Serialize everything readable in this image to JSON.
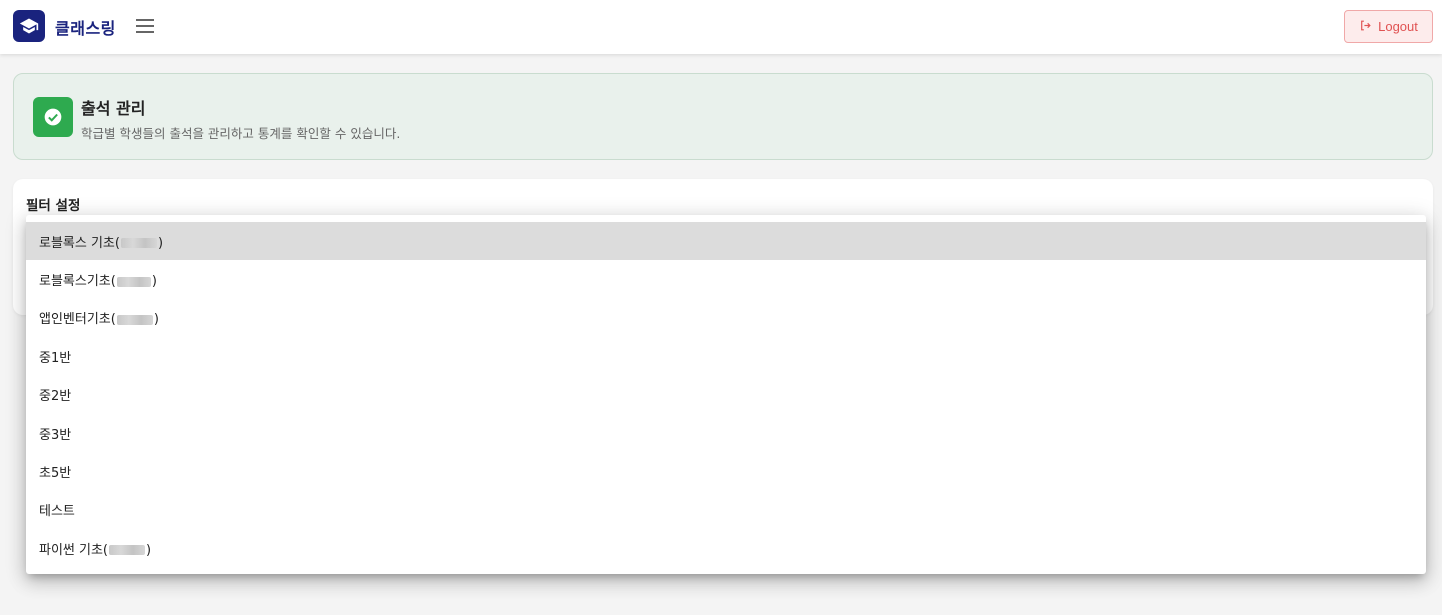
{
  "app": {
    "brand": "클래스링",
    "logout_label": "Logout"
  },
  "header": {
    "title": "출석 관리",
    "subtitle": "학급별 학생들의 출석을 관리하고 통계를 확인할 수 있습니다."
  },
  "filter": {
    "title": "필터 설정"
  },
  "dropdown": {
    "options": [
      {
        "prefix": "로블록스 기초(",
        "suffix": ")",
        "selected": true
      },
      {
        "prefix": "로블록스기초(",
        "suffix": ")",
        "selected": false
      },
      {
        "prefix": "앱인벤터기초(",
        "suffix": ")",
        "selected": false
      },
      {
        "prefix": "중1반",
        "suffix": "",
        "selected": false
      },
      {
        "prefix": "중2반",
        "suffix": "",
        "selected": false
      },
      {
        "prefix": "중3반",
        "suffix": "",
        "selected": false
      },
      {
        "prefix": "초5반",
        "suffix": "",
        "selected": false
      },
      {
        "prefix": "테스트",
        "suffix": "",
        "selected": false
      },
      {
        "prefix": "파이썬 기초(",
        "suffix": ")",
        "selected": false
      }
    ]
  },
  "colors": {
    "brand": "#1a237e",
    "success": "#2eaa4f",
    "logout": "#e05252"
  }
}
